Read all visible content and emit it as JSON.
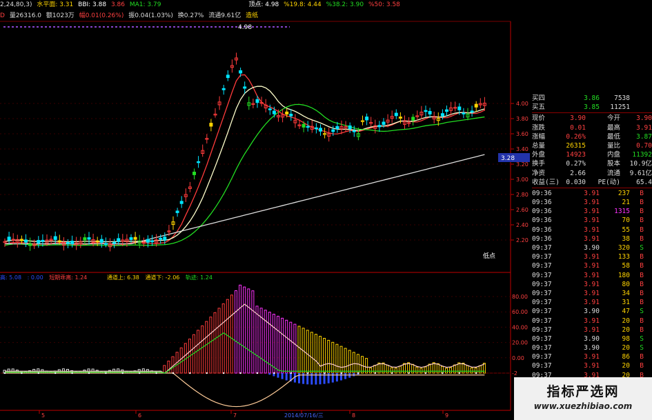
{
  "top_bar": {
    "ma_params": "2,24,80,3)",
    "level_label": "水平面: 3.31",
    "bbi": "BBI: 3.88",
    "bbi_value2": "3.86",
    "ma1": "MA1: 3.79",
    "top_point": "顶点: 4.98",
    "fib_19": "%19.8: 4.44",
    "fib_38": "%38.2: 3.90",
    "fib_50": "%50: 3.58"
  },
  "info_bar": {
    "prefix": "D",
    "volume": "量26316.0",
    "amount": "额1023万",
    "change": "幅0.01(0.26%)",
    "amplitude": "振0.04(1.03%)",
    "turnover": "换0.27%",
    "float_cap": "流通9.61亿",
    "paper": "造纸"
  },
  "chart_labels": {
    "peak_label": "4.98",
    "low_label": "低点",
    "current_price_tag": "3.28"
  },
  "indicator_bar": {
    "name1": "高: 5.08",
    "val0": ": 0.00",
    "name2": "短期乖离: 1.24",
    "upper": "通道上: 6.38",
    "lower": "通道下: -2.06",
    "track": "轨迹: 1.24"
  },
  "x_axis": {
    "labels": [
      "5",
      "6",
      "7",
      "2014/07/16/三",
      "8",
      "9"
    ],
    "highlighted_index": 3
  },
  "price_axis": [
    "4.00",
    "3.80",
    "3.60",
    "3.40",
    "3.20",
    "3.00",
    "2.80",
    "2.60",
    "2.40",
    "2.20"
  ],
  "indicator_axis": [
    "80.00",
    "60.00",
    "40.00",
    "20.00",
    "0.00",
    "-2"
  ],
  "colors": {
    "up": "#ff3b3b",
    "down": "#00e5ff",
    "yellow": "#ffd400",
    "green": "#22dd22",
    "magenta": "#ff33ff",
    "axis_red": "#c00000",
    "blue": "#2b4cff"
  },
  "quote_panel": {
    "book": [
      {
        "label": "买四",
        "price": "3.86",
        "vol": "7538"
      },
      {
        "label": "买五",
        "price": "3.85",
        "vol": "11251"
      }
    ],
    "stats": [
      {
        "l1": "现价",
        "v1": "3.90",
        "l2": "今开",
        "v2": "3.90",
        "c1": "#ff4040",
        "c2": "#ff4040"
      },
      {
        "l1": "涨跌",
        "v1": "0.01",
        "l2": "最高",
        "v2": "3.91",
        "c1": "#ff4040",
        "c2": "#ff4040"
      },
      {
        "l1": "涨幅",
        "v1": "0.26%",
        "l2": "最低",
        "v2": "3.87",
        "c1": "#ff4040",
        "c2": "#22dd22"
      },
      {
        "l1": "总量",
        "v1": "26315",
        "l2": "量比",
        "v2": "0.70",
        "c1": "#ffd400",
        "c2": "#ff4040"
      },
      {
        "l1": "外盘",
        "v1": "14923",
        "l2": "内盘",
        "v2": "11392",
        "c1": "#ff4040",
        "c2": "#22dd22"
      },
      {
        "l1": "换手",
        "v1": "0.27%",
        "l2": "股本",
        "v2": "10.9亿",
        "c1": "#ddd",
        "c2": "#ddd"
      },
      {
        "l1": "净资",
        "v1": "2.66",
        "l2": "流通",
        "v2": "9.61亿",
        "c1": "#ddd",
        "c2": "#ddd"
      },
      {
        "l1": "收益(三)",
        "v1": "0.030",
        "l2": "PE(动)",
        "v2": "65.4",
        "c1": "#ddd",
        "c2": "#ddd"
      }
    ],
    "ticks": [
      {
        "time": "09:36",
        "price": "3.91",
        "vol": "237",
        "side": "B"
      },
      {
        "time": "09:36",
        "price": "3.91",
        "vol": "21",
        "side": "B"
      },
      {
        "time": "09:36",
        "price": "3.91",
        "vol": "1315",
        "side": "B"
      },
      {
        "time": "09:36",
        "price": "3.91",
        "vol": "70",
        "side": "B"
      },
      {
        "time": "09:36",
        "price": "3.91",
        "vol": "55",
        "side": "B"
      },
      {
        "time": "09:36",
        "price": "3.91",
        "vol": "38",
        "side": "B"
      },
      {
        "time": "09:37",
        "price": "3.90",
        "vol": "320",
        "side": "S"
      },
      {
        "time": "09:37",
        "price": "3.91",
        "vol": "133",
        "side": "B"
      },
      {
        "time": "09:37",
        "price": "3.91",
        "vol": "58",
        "side": "B"
      },
      {
        "time": "09:37",
        "price": "3.91",
        "vol": "180",
        "side": "B"
      },
      {
        "time": "09:37",
        "price": "3.91",
        "vol": "80",
        "side": "B"
      },
      {
        "time": "09:37",
        "price": "3.91",
        "vol": "34",
        "side": "B"
      },
      {
        "time": "09:37",
        "price": "3.91",
        "vol": "31",
        "side": "B"
      },
      {
        "time": "09:37",
        "price": "3.90",
        "vol": "47",
        "side": "S"
      },
      {
        "time": "09:37",
        "price": "3.91",
        "vol": "20",
        "side": "B"
      },
      {
        "time": "09:37",
        "price": "3.91",
        "vol": "20",
        "side": "B"
      },
      {
        "time": "09:37",
        "price": "3.90",
        "vol": "98",
        "side": "S"
      },
      {
        "time": "09:37",
        "price": "3.90",
        "vol": "20",
        "side": "S"
      },
      {
        "time": "09:37",
        "price": "3.91",
        "vol": "86",
        "side": "B"
      },
      {
        "time": "09:37",
        "price": "3.91",
        "vol": "20",
        "side": "B"
      },
      {
        "time": "09:37",
        "price": "3.91",
        "vol": "20",
        "side": "B"
      }
    ]
  },
  "watermark": {
    "title": "指标严选网",
    "url": "www.xuezhibiao.com"
  }
}
